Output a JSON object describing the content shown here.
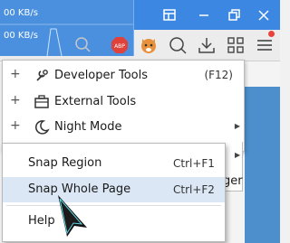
{
  "network": {
    "line1": "00 KB/s",
    "line2": "00 KB/s"
  },
  "toolbar": {
    "adblock_badge": "ABP"
  },
  "menu": {
    "items": [
      {
        "label": "Developer Tools",
        "shortcut": "(F12)",
        "icon": "developer-tools-icon"
      },
      {
        "label": "External Tools",
        "shortcut": "",
        "icon": "toolbox-icon"
      },
      {
        "label": "Night Mode",
        "shortcut": "",
        "icon": "moon-icon"
      }
    ],
    "hidden_item_fragment": "ger"
  },
  "submenu": {
    "items": [
      {
        "label": "Snap Region",
        "shortcut": "Ctrl+F1"
      },
      {
        "label": "Snap Whole Page",
        "shortcut": "Ctrl+F2"
      },
      {
        "label": "Help",
        "shortcut": ""
      }
    ]
  },
  "colors": {
    "titlebar": "#3b87e1",
    "highlight": "#dbe7f5",
    "notification": "#e8423a"
  }
}
